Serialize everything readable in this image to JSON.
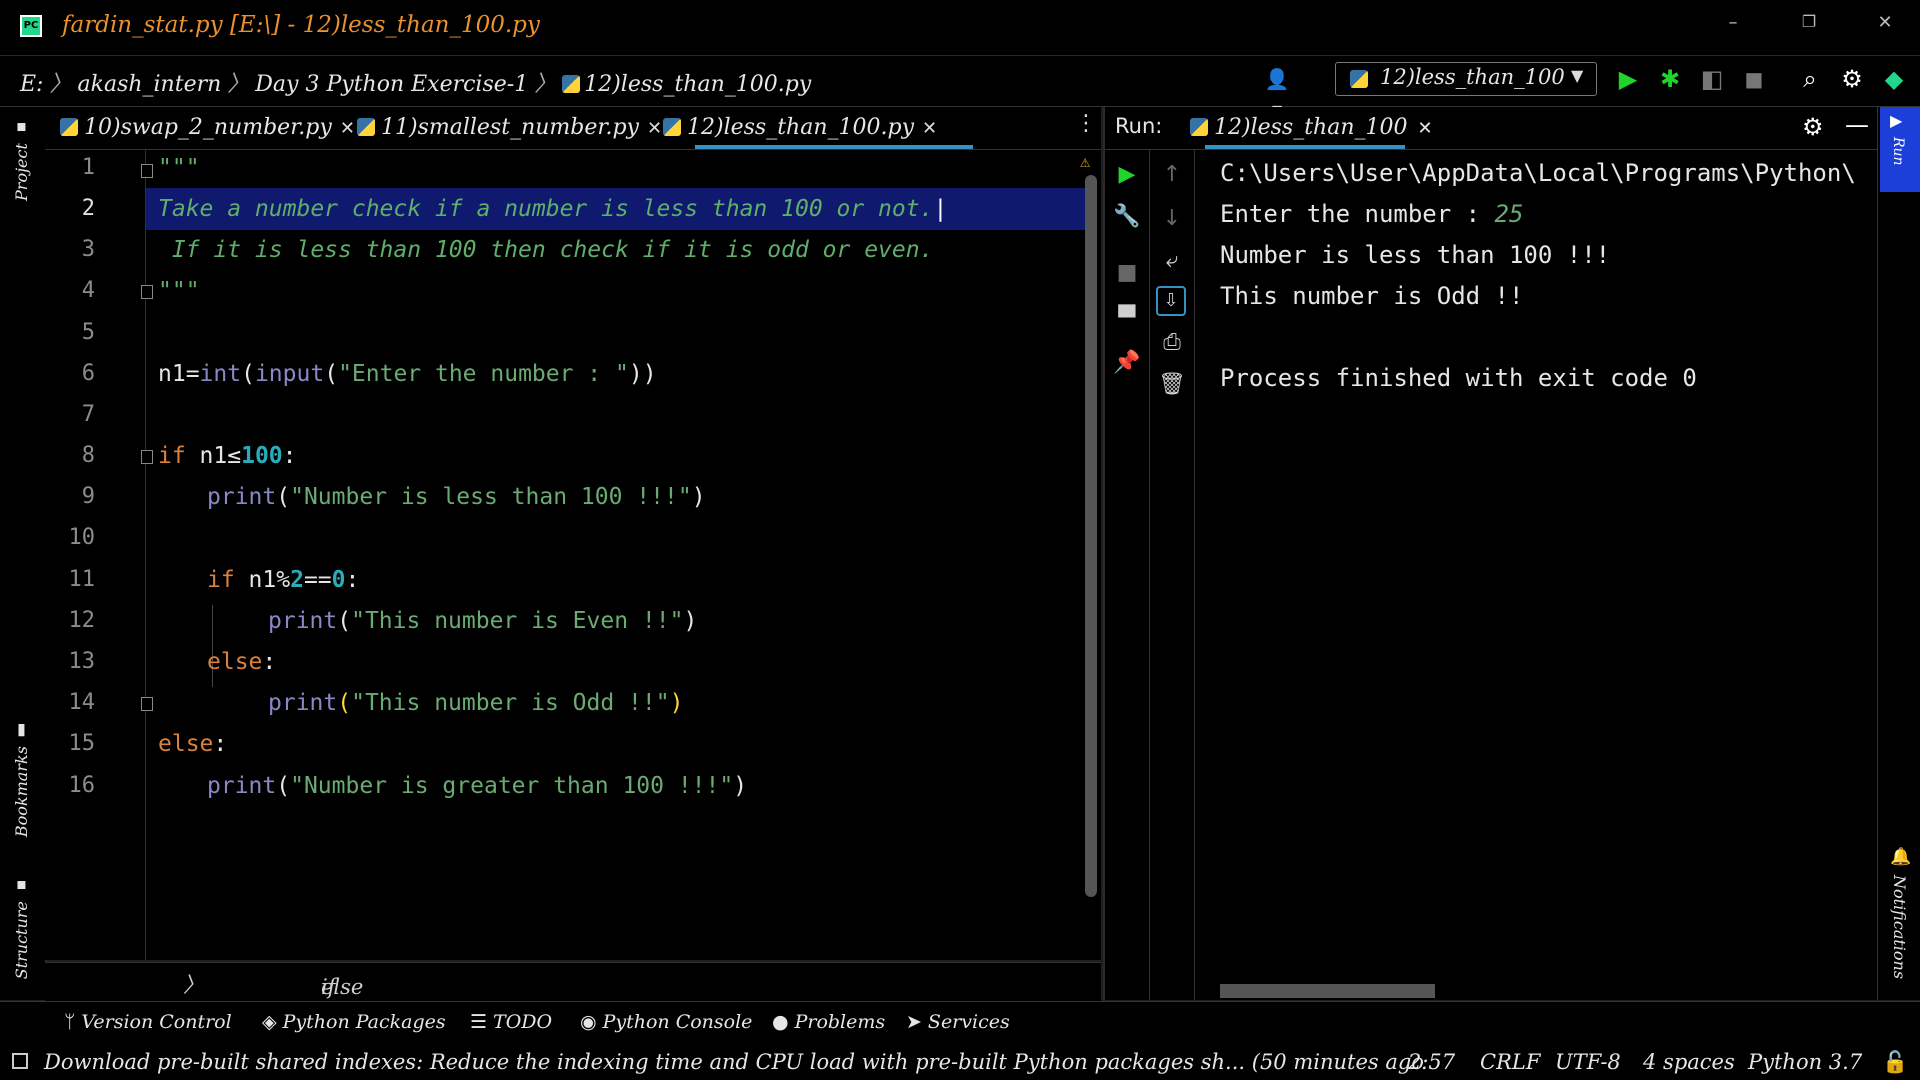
{
  "window": {
    "title": "fardin_stat.py [E:\\] - 12)less_than_100.py",
    "minimize": "–",
    "restore": "❐",
    "close": "✕"
  },
  "breadcrumb": [
    "E:",
    "akash_intern",
    "Day 3 Python Exercise-1",
    "12)less_than_100.py"
  ],
  "run_config": {
    "label": "12)less_than_100"
  },
  "editor_tabs": [
    {
      "label": "10)swap_2_number.py"
    },
    {
      "label": "11)smallest_number.py"
    },
    {
      "label": "12)less_than_100.py",
      "active": true
    }
  ],
  "left_strip": {
    "project": "Project",
    "bookmarks": "Bookmarks",
    "structure": "Structure"
  },
  "right_strip": {
    "run": "Run",
    "notifications": "Notifications"
  },
  "code": {
    "line_numbers": [
      "1",
      "2",
      "3",
      "4",
      "5",
      "6",
      "7",
      "8",
      "9",
      "10",
      "11",
      "12",
      "13",
      "14",
      "15",
      "16"
    ],
    "l1": "\"\"\"",
    "l2": "Take a number check if a number is less than 100 or not.",
    "l3": " If it is less than 100 then check if it is odd or even.",
    "l4": "\"\"\"",
    "l6_var": "n1=",
    "l6_int": "int",
    "l6_p1": "(",
    "l6_input": "input",
    "l6_p2": "(",
    "l6_str": "\"Enter the number : \"",
    "l6_p3": "))",
    "l8_kw": "if",
    "l8_rest": " n1≤",
    "l8_num": "100",
    "l8_colon": ":",
    "l9_fn": "print",
    "l9_str": "\"Number is less than 100 !!!\"",
    "l11_kw": "if",
    "l11_rest": " n1%",
    "l11_num1": "2",
    "l11_eq": "==",
    "l11_num2": "0",
    "l11_colon": ":",
    "l12_fn": "print",
    "l12_str": "\"This number is Even !!\"",
    "l13_kw": "else",
    "l13_colon": ":",
    "l14_fn": "print",
    "l14_str": "\"This number is Odd !!\"",
    "l15_kw": "else",
    "l15_colon": ":",
    "l16_fn": "print",
    "l16_str": "\"Number is greater than 100 !!!\""
  },
  "editor_breadcrumb": [
    "if n1<=100",
    "else"
  ],
  "run_panel": {
    "title": "Run:",
    "tab": "12)less_than_100",
    "console": {
      "path": "C:\\Users\\User\\AppData\\Local\\Programs\\Python\\",
      "prompt": "Enter the number : ",
      "input": "25",
      "out1": "Number is less than 100 !!!",
      "out2": "This number is Odd !!",
      "exit": "Process finished with exit code 0"
    }
  },
  "bottom_tabs": [
    {
      "label": "Version Control",
      "icon": "version-control-icon"
    },
    {
      "label": "Python Packages",
      "icon": "packages-icon"
    },
    {
      "label": "TODO",
      "icon": "todo-icon"
    },
    {
      "label": "Python Console",
      "icon": "python-console-icon"
    },
    {
      "label": "Problems",
      "icon": "problems-icon"
    },
    {
      "label": "Services",
      "icon": "services-icon"
    }
  ],
  "status_bar": {
    "message": "Download pre-built shared indexes: Reduce the indexing time and CPU load with pre-built Python packages sh... (50 minutes ago",
    "position": "2:57",
    "line_ending": "CRLF",
    "encoding": "UTF-8",
    "indent": "4 spaces",
    "interpreter": "Python 3.7"
  },
  "colors": {
    "title_orange": "#e8912d",
    "accent_blue": "#3592c4",
    "run_green": "#21d32a",
    "highlight_line": "#0f1a6e"
  }
}
